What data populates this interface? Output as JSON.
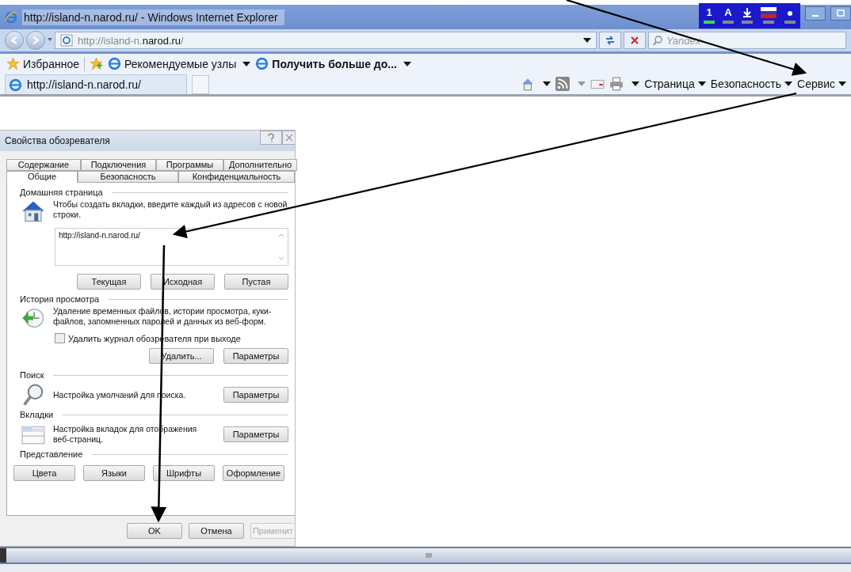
{
  "window": {
    "title": "http://island-n.narod.ru/ - Windows Internet Explorer"
  },
  "language_bar": {
    "items": [
      "1",
      "A"
    ]
  },
  "address_bar": {
    "url": "http://island-n.**narod.ru**/",
    "search_placeholder": "Yandex"
  },
  "favorites_bar": {
    "favorites": "Избранное",
    "items": [
      {
        "label": "Рекомендуемые узлы",
        "bold": false
      },
      {
        "label": "Получить больше до...",
        "bold": true
      }
    ]
  },
  "tab": {
    "title": "http://island-n.narod.ru/"
  },
  "command_bar": {
    "menus": [
      "Страница",
      "Безопасность",
      "Сервис"
    ]
  },
  "dialog": {
    "title": "Свойства обозревателя",
    "tabs_back": [
      {
        "label": "Содержание"
      },
      {
        "label": "Подключения"
      },
      {
        "label": "Программы"
      },
      {
        "label": "Дополнительно"
      }
    ],
    "tabs_front": [
      {
        "label": "Общие",
        "selected": true
      },
      {
        "label": "Безопасность",
        "selected": false
      },
      {
        "label": "Конфиденциальность",
        "selected": false
      }
    ],
    "home": {
      "heading": "Домашняя страница",
      "description": "Чтобы создать вкладки, введите каждый из адресов с новой строки.",
      "value": "http://island-n.narod.ru/",
      "buttons": [
        "Текущая",
        "Исходная",
        "Пустая"
      ]
    },
    "history": {
      "heading": "История просмотра",
      "description": "Удаление временных файлов, истории просмотра, куки-файлов, запомненных паролей и данных из веб-форм.",
      "checkbox": {
        "label": "Удалить журнал обозревателя при выходе",
        "checked": false
      },
      "buttons": [
        "Удалить...",
        "Параметры"
      ]
    },
    "search": {
      "heading": "Поиск",
      "description": "Настройка умолчаний для поиска.",
      "button": "Параметры"
    },
    "tabs": {
      "heading": "Вкладки",
      "description": "Настройка вкладок для отображения веб-страниц.",
      "button": "Параметры"
    },
    "appearance": {
      "heading": "Представление",
      "buttons": [
        "Цвета",
        "Языки",
        "Шрифты",
        "Оформление"
      ]
    },
    "footer": [
      {
        "label": "OK",
        "disabled": false
      },
      {
        "label": "Отмена",
        "disabled": false
      },
      {
        "label": "Применит",
        "disabled": true
      }
    ]
  }
}
